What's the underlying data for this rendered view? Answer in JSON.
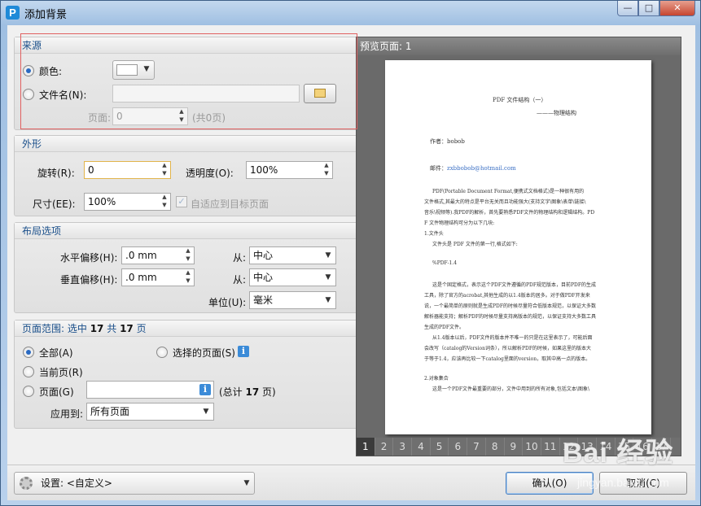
{
  "window": {
    "app_icon": "P",
    "title": "添加背景",
    "minimize": "—",
    "maximize": "□",
    "close": "✕"
  },
  "source": {
    "header": "来源",
    "color_label": "颜色:",
    "file_label": "文件名(N):",
    "page_label": "页面:",
    "page_value": "0",
    "page_total": "(共0页)",
    "file_value": ""
  },
  "appearance": {
    "header": "外形",
    "rotate_label": "旋转(R):",
    "rotate_value": "0",
    "opacity_label": "透明度(O):",
    "opacity_value": "100%",
    "size_label": "尺寸(EE):",
    "size_value": "100%",
    "fit_label": "自适应到目标页面"
  },
  "layout": {
    "header": "布局选项",
    "h_offset_label": "水平偏移(H):",
    "h_offset_value": ".0 mm",
    "v_offset_label": "垂直偏移(H):",
    "v_offset_value": ".0 mm",
    "from_label": "从:",
    "from_h_value": "中心",
    "from_v_value": "中心",
    "unit_label": "单位(U):",
    "unit_value": "毫米"
  },
  "page_range": {
    "header_prefix": "页面范围: 选中",
    "selected": "17",
    "header_mid": "共",
    "total": "17",
    "header_suffix": "页",
    "all_label": "全部(A)",
    "selected_pages_label": "选择的页面(S)",
    "current_label": "当前页(R)",
    "pages_label": "页面(G)",
    "pages_value": "",
    "total_prefix": "(总计",
    "total_value": "17",
    "total_suffix": "页)",
    "apply_label": "应用到:",
    "apply_value": "所有页面"
  },
  "preview": {
    "header": "预览页面: 1",
    "pages": [
      "1",
      "2",
      "3",
      "4",
      "5",
      "6",
      "7",
      "8",
      "9",
      "10",
      "11",
      "12",
      "13",
      "14",
      "15",
      "16",
      "17"
    ],
    "current_page": "1",
    "doc": {
      "title": "PDF 文件结构（一）",
      "subtitle": "———物理结构",
      "author": "作者：bobob",
      "email_label": "邮件：",
      "email": "zxbbobob@hotmail.com",
      "p1": "PDF(Portable   Document   Format,便携式文档格式)是一种很有用的",
      "p2": "文件格式,其最大的特点是平台无关而且功能强大(支持文字\\图象\\表单\\链接\\",
      "p3": "音乐\\视频等).我PDF的解析，首先要熟悉PDF文件的物理结构和逻辑结构。PD",
      "p4": "F 文件物理结构可分为以下几块:",
      "s1": "1.文件头",
      "s1a": "文件头是 PDF 文件的第一行,格式如下:",
      "s1b": "%PDF-1.4",
      "p5": "这是个固定格式，表示这个PDF文件遵循的PDF规范版本，目前PDF的生成",
      "p6": "工具，除了官方的acrobat,其他生成的以1.4版本的居多。对于做PDF开发来",
      "p7": "说，一个最简单的原则就是生成PDF的时候尽量符合低版本规范，以保证大多数",
      "p8": "解析器能支持；解析PDF的时候尽量支持高版本的规范，以保证支持大多数工具",
      "p9": "生成的PDF文件。",
      "p10": "从1.4版本以后，PDF文件的版本并不唯一的只是在这里表示了，可能后面",
      "p11": "会改写（catalog的Version词条），所以解析PDF的时候，如果这里的版本大",
      "p12": "于等于1.4，应该再比较一下catalog里面的version，取其中高一点的版本。",
      "s2": "2.对象集合",
      "p13": "这是一个PDF文件最重要的部分，文件中用到的所有对象,包括文本\\图象\\"
    }
  },
  "footer": {
    "settings_label": "设置:",
    "settings_value": "<自定义>",
    "ok_label": "确认(O)",
    "cancel_label": "取消(C)"
  },
  "watermark": {
    "brand": "Bai 经验",
    "url": "jingyan.baidu.com"
  }
}
